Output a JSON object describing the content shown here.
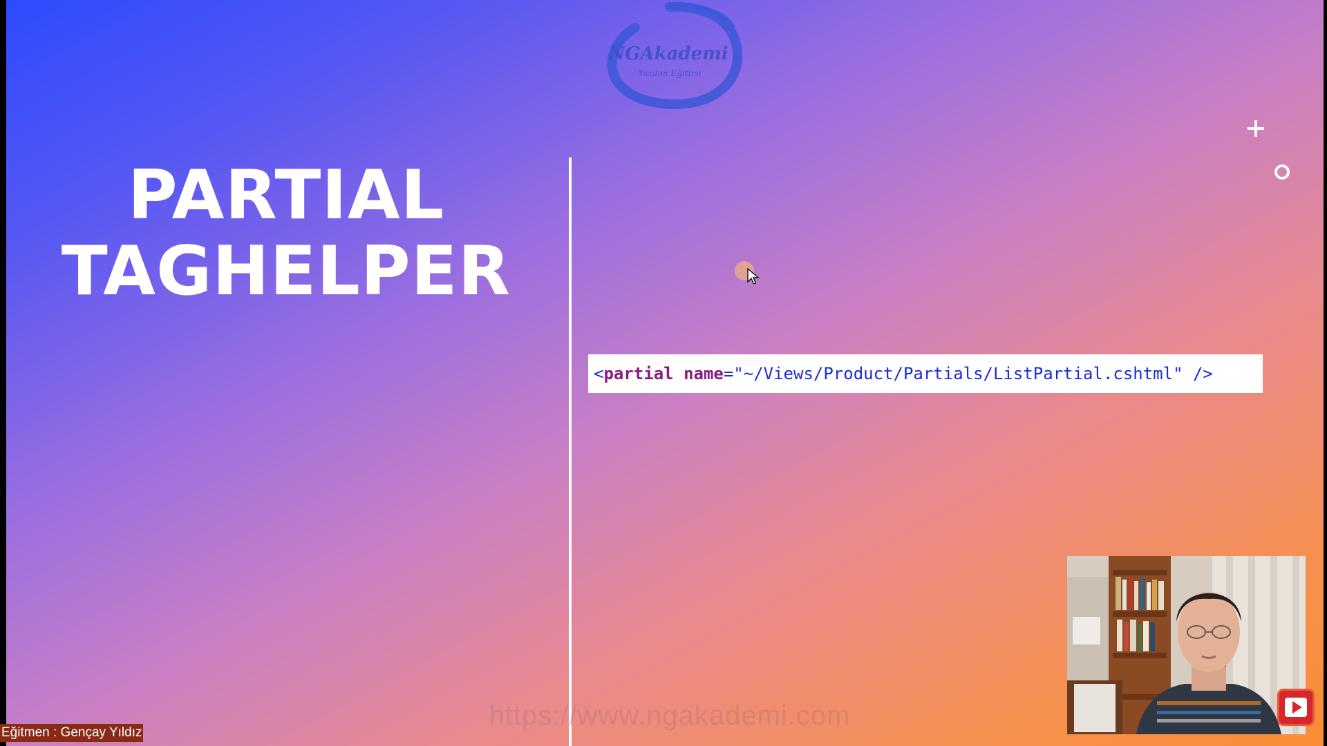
{
  "slide": {
    "logo": {
      "brand": "NGAkademi",
      "tagline": "Yazılım Eğitimi"
    },
    "title": {
      "line1": "PARTIAL",
      "line2": "TAGHELPER"
    },
    "code": {
      "open": "<",
      "tag": "partial",
      "attr": "name",
      "equals": "=",
      "value": "\"~/Views/Product/Partials/ListPartial.cshtml\"",
      "close": " />"
    },
    "controls": {
      "plus_icon": "plus-icon",
      "circle_icon": "circle-icon"
    },
    "watermark": "https://www.ngakademi.com",
    "instructor_credit": "Eğitmen : Gençay Yıldız"
  },
  "colors": {
    "gradient_start": "#2d4bff",
    "gradient_mid": "#c97fc4",
    "gradient_end": "#f98e35",
    "code_tag": "#8a1a7f",
    "code_string": "#1b2bd9"
  }
}
